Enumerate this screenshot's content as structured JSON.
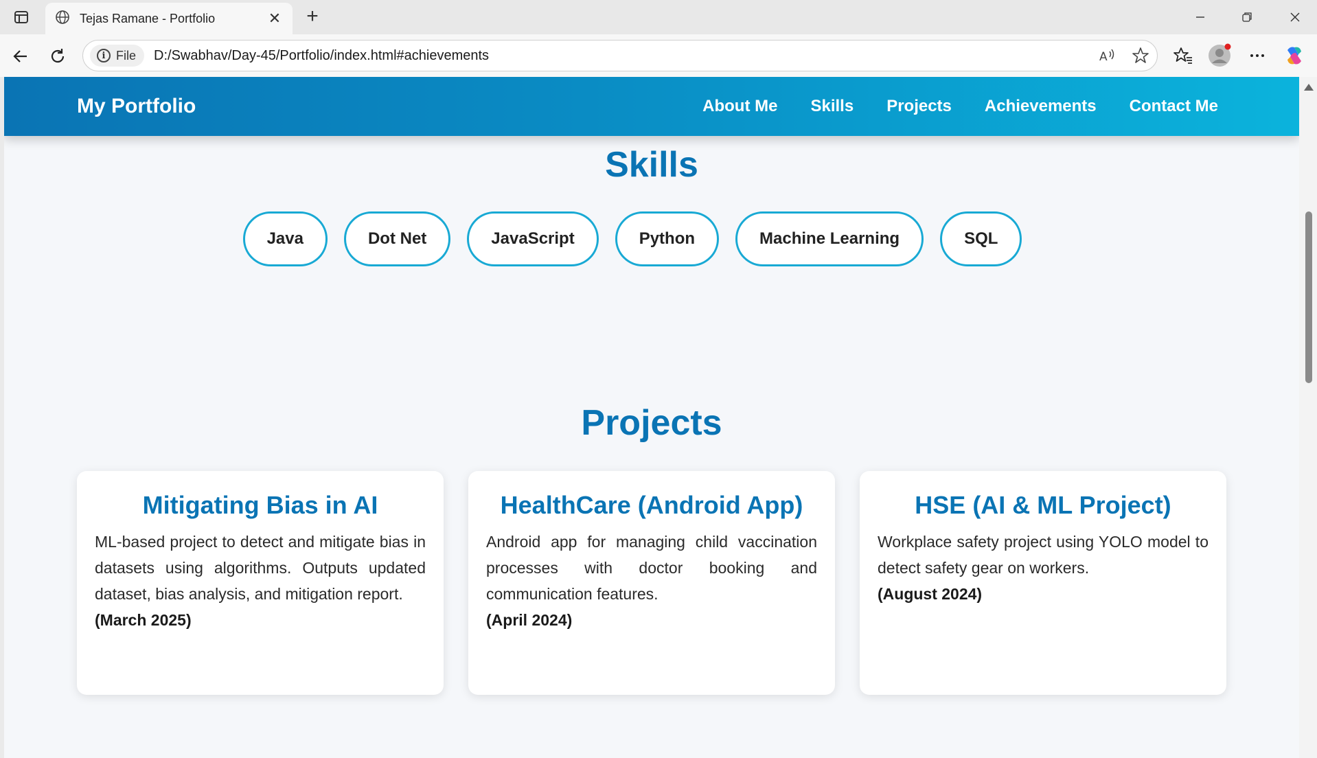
{
  "browser": {
    "tab_title": "Tejas Ramane - Portfolio",
    "file_label": "File",
    "url": "D:/Swabhav/Day-45/Portfolio/index.html#achievements"
  },
  "site": {
    "brand": "My Portfolio",
    "nav": [
      "About Me",
      "Skills",
      "Projects",
      "Achievements",
      "Contact Me"
    ]
  },
  "skills": {
    "title": "Skills",
    "items": [
      "Java",
      "Dot Net",
      "JavaScript",
      "Python",
      "Machine Learning",
      "SQL"
    ]
  },
  "projects": {
    "title": "Projects",
    "items": [
      {
        "title": "Mitigating Bias in AI",
        "description": "ML-based project to detect and mitigate bias in datasets using algorithms. Outputs updated dataset, bias analysis, and mitigation report.",
        "date": "(March 2025)"
      },
      {
        "title": "HealthCare (Android App)",
        "description": "Android app for managing child vaccination processes with doctor booking and communication features.",
        "date": "(April 2024)"
      },
      {
        "title": "HSE (AI & ML Project)",
        "description": "Workplace safety project using YOLO model to detect safety gear on workers.",
        "date": "(August 2024)"
      }
    ]
  }
}
